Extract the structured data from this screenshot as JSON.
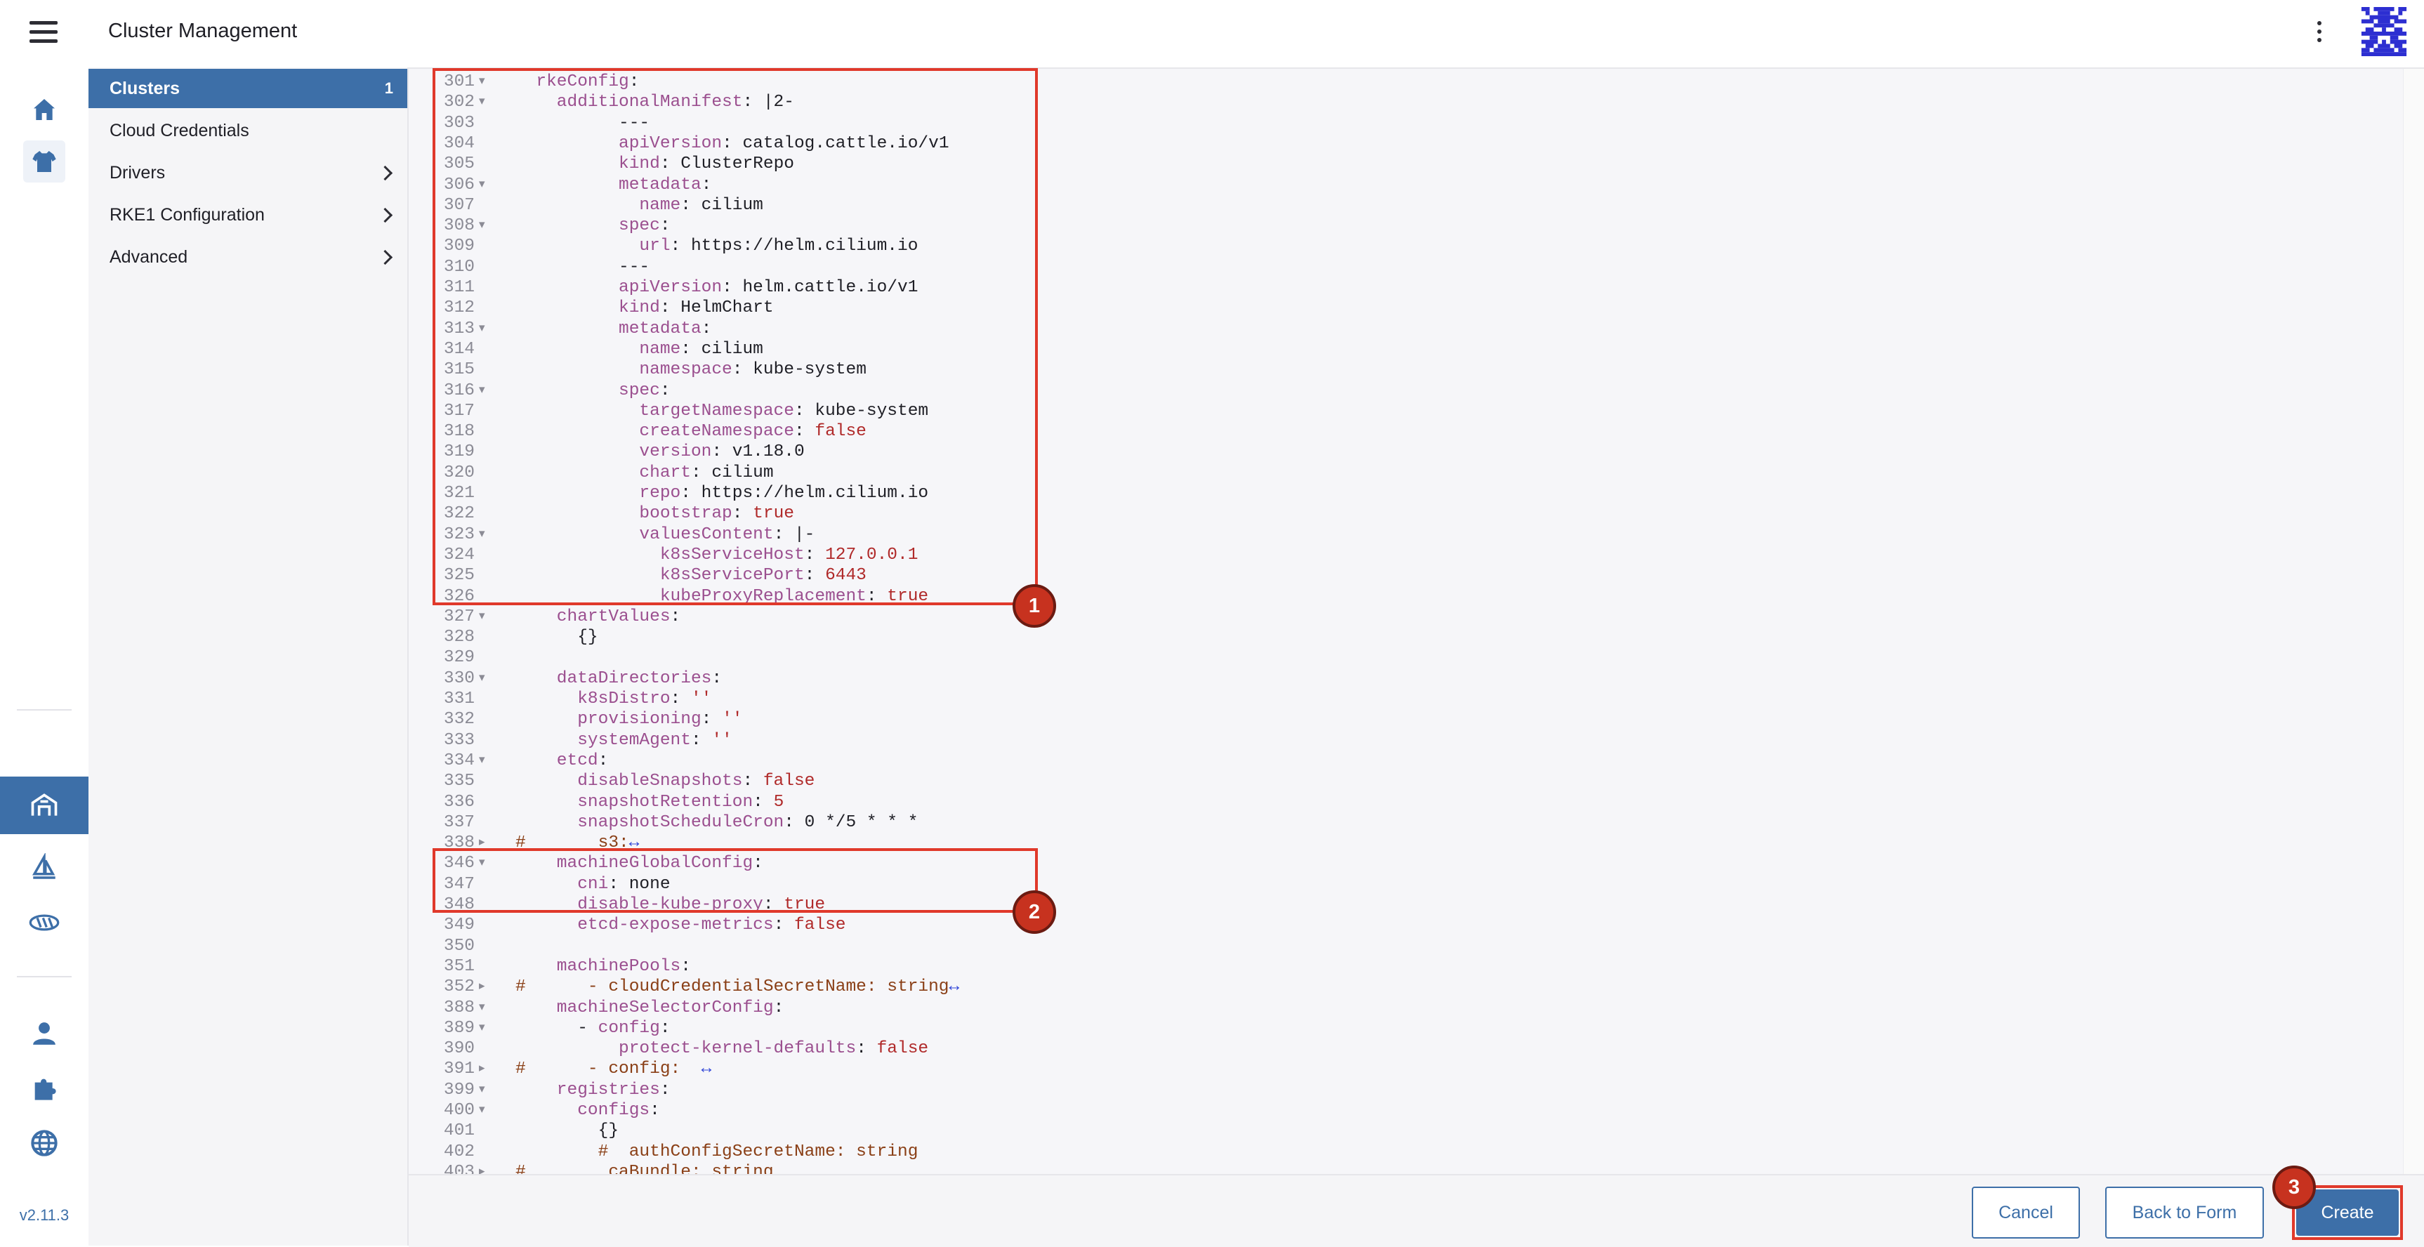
{
  "header": {
    "title": "Cluster Management"
  },
  "version": "v2.11.3",
  "sidebar": {
    "items": [
      {
        "label": "Clusters",
        "count": "1"
      },
      {
        "label": "Cloud Credentials"
      },
      {
        "label": "Drivers"
      },
      {
        "label": "RKE1 Configuration"
      },
      {
        "label": "Advanced"
      }
    ]
  },
  "editor": {
    "lines": [
      {
        "n": "301",
        "f": "▾",
        "html": "<span class=\"k\">  rkeConfig</span>:"
      },
      {
        "n": "302",
        "f": "▾",
        "html": "<span class=\"k\">    additionalManifest</span>: |2-"
      },
      {
        "n": "303",
        "f": "",
        "html": "          ---"
      },
      {
        "n": "304",
        "f": "",
        "html": "<span class=\"k\">          apiVersion</span>: catalog.cattle.io/v1"
      },
      {
        "n": "305",
        "f": "",
        "html": "<span class=\"k\">          kind</span>: ClusterRepo"
      },
      {
        "n": "306",
        "f": "▾",
        "html": "<span class=\"k\">          metadata</span>:"
      },
      {
        "n": "307",
        "f": "",
        "html": "<span class=\"k\">            name</span>: cilium"
      },
      {
        "n": "308",
        "f": "▾",
        "html": "<span class=\"k\">          spec</span>:"
      },
      {
        "n": "309",
        "f": "",
        "html": "<span class=\"k\">            url</span>: https://helm.cilium.io"
      },
      {
        "n": "310",
        "f": "",
        "html": "          ---"
      },
      {
        "n": "311",
        "f": "",
        "html": "<span class=\"k\">          apiVersion</span>: helm.cattle.io/v1"
      },
      {
        "n": "312",
        "f": "",
        "html": "<span class=\"k\">          kind</span>: HelmChart"
      },
      {
        "n": "313",
        "f": "▾",
        "html": "<span class=\"k\">          metadata</span>:"
      },
      {
        "n": "314",
        "f": "",
        "html": "<span class=\"k\">            name</span>: cilium"
      },
      {
        "n": "315",
        "f": "",
        "html": "<span class=\"k\">            namespace</span>: kube-system"
      },
      {
        "n": "316",
        "f": "▾",
        "html": "<span class=\"k\">          spec</span>:"
      },
      {
        "n": "317",
        "f": "",
        "html": "<span class=\"k\">            targetNamespace</span>: kube-system"
      },
      {
        "n": "318",
        "f": "",
        "html": "<span class=\"k\">            createNamespace</span>: <span class=\"b\">false</span>"
      },
      {
        "n": "319",
        "f": "",
        "html": "<span class=\"k\">            version</span>: v1.18.0"
      },
      {
        "n": "320",
        "f": "",
        "html": "<span class=\"k\">            chart</span>: cilium"
      },
      {
        "n": "321",
        "f": "",
        "html": "<span class=\"k\">            repo</span>: https://helm.cilium.io"
      },
      {
        "n": "322",
        "f": "",
        "html": "<span class=\"k\">            bootstrap</span>: <span class=\"b\">true</span>"
      },
      {
        "n": "323",
        "f": "▾",
        "html": "<span class=\"k\">            valuesContent</span>: |-"
      },
      {
        "n": "324",
        "f": "",
        "html": "<span class=\"k\">              k8sServiceHost</span>: <span class=\"n\">127.0.0.1</span>"
      },
      {
        "n": "325",
        "f": "",
        "html": "<span class=\"k\">              k8sServicePort</span>: <span class=\"n\">6443</span>"
      },
      {
        "n": "326",
        "f": "",
        "html": "<span class=\"k\">              kubeProxyReplacement</span>: <span class=\"b\">true</span>"
      },
      {
        "n": "327",
        "f": "▾",
        "html": "<span class=\"k\">    chartValues</span>:"
      },
      {
        "n": "328",
        "f": "",
        "html": "      {}"
      },
      {
        "n": "329",
        "f": "",
        "html": ""
      },
      {
        "n": "330",
        "f": "▾",
        "html": "<span class=\"k\">    dataDirectories</span>:"
      },
      {
        "n": "331",
        "f": "",
        "html": "<span class=\"k\">      k8sDistro</span>: <span class=\"s\">''</span>"
      },
      {
        "n": "332",
        "f": "",
        "html": "<span class=\"k\">      provisioning</span>: <span class=\"s\">''</span>"
      },
      {
        "n": "333",
        "f": "",
        "html": "<span class=\"k\">      systemAgent</span>: <span class=\"s\">''</span>"
      },
      {
        "n": "334",
        "f": "▾",
        "html": "<span class=\"k\">    etcd</span>:"
      },
      {
        "n": "335",
        "f": "",
        "html": "<span class=\"k\">      disableSnapshots</span>: <span class=\"b\">false</span>"
      },
      {
        "n": "336",
        "f": "",
        "html": "<span class=\"k\">      snapshotRetention</span>: <span class=\"n\">5</span>"
      },
      {
        "n": "337",
        "f": "",
        "html": "<span class=\"k\">      snapshotScheduleCron</span>: 0 */5 * * *"
      },
      {
        "n": "338",
        "f": "▸",
        "html": "<span class=\"c\">#       s3:</span><span class=\"ex\">↔</span>"
      },
      {
        "n": "346",
        "f": "▾",
        "html": "<span class=\"k\">    machineGlobalConfig</span>:"
      },
      {
        "n": "347",
        "f": "",
        "html": "<span class=\"k\">      cni</span>: none"
      },
      {
        "n": "348",
        "f": "",
        "html": "<span class=\"k\">      disable-kube-proxy</span>: <span class=\"b\">true</span>"
      },
      {
        "n": "349",
        "f": "",
        "html": "<span class=\"k\">      etcd-expose-metrics</span>: <span class=\"b\">false</span>"
      },
      {
        "n": "350",
        "f": "",
        "html": ""
      },
      {
        "n": "351",
        "f": "",
        "html": "<span class=\"k\">    machinePools</span>:"
      },
      {
        "n": "352",
        "f": "▸",
        "html": "<span class=\"c\">#      - cloudCredentialSecretName: string</span><span class=\"ex\">↔</span>"
      },
      {
        "n": "388",
        "f": "▾",
        "html": "<span class=\"k\">    machineSelectorConfig</span>:"
      },
      {
        "n": "389",
        "f": "▾",
        "html": "      - <span class=\"k\">config</span>:"
      },
      {
        "n": "390",
        "f": "",
        "html": "<span class=\"k\">          protect-kernel-defaults</span>: <span class=\"b\">false</span>"
      },
      {
        "n": "391",
        "f": "▸",
        "html": "<span class=\"c\">#      - config:  </span><span class=\"ex\">↔</span>"
      },
      {
        "n": "399",
        "f": "▾",
        "html": "<span class=\"k\">    registries</span>:"
      },
      {
        "n": "400",
        "f": "▾",
        "html": "<span class=\"k\">      configs</span>:"
      },
      {
        "n": "401",
        "f": "",
        "html": "        {}"
      },
      {
        "n": "402",
        "f": "",
        "html": "<span class=\"c\">        #  authConfigSecretName: string</span>"
      },
      {
        "n": "403",
        "f": "▸",
        "html": "<span class=\"c\">#        caBundle: string</span>"
      }
    ]
  },
  "callouts": {
    "one": "1",
    "two": "2",
    "three": "3"
  },
  "footer": {
    "cancel": "Cancel",
    "back": "Back to Form",
    "create": "Create"
  },
  "colors": {
    "accent": "#3d6fa8",
    "highlight": "#e0392b",
    "badge": "#c7321f"
  }
}
